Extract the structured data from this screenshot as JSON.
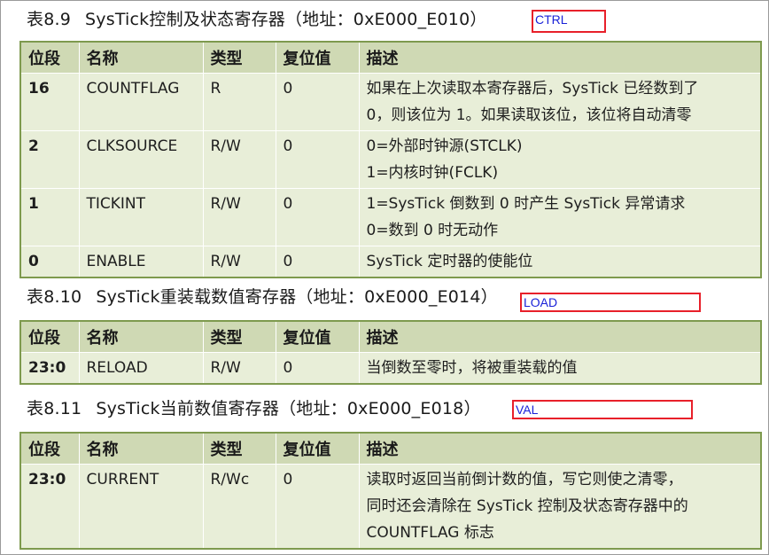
{
  "tables": [
    {
      "number": "表8.9",
      "title": "SysTick控制及状态寄存器（地址：0xE000_E010）",
      "annotation": "CTRL",
      "headers": [
        "位段",
        "名称",
        "类型",
        "复位值",
        "描述"
      ],
      "rows": [
        {
          "bits": "16",
          "name": "COUNTFLAG",
          "type": "R",
          "reset": "0",
          "desc": [
            "如果在上次读取本寄存器后，SysTick 已经数到了",
            "0，则该位为 1。如果读取该位，该位将自动清零"
          ]
        },
        {
          "bits": "2",
          "name": "CLKSOURCE",
          "type": "R/W",
          "reset": "0",
          "desc": [
            "0=外部时钟源(STCLK)",
            "1=内核时钟(FCLK)"
          ]
        },
        {
          "bits": "1",
          "name": "TICKINT",
          "type": "R/W",
          "reset": "0",
          "desc": [
            "1=SysTick 倒数到 0 时产生 SysTick 异常请求",
            "0=数到 0 时无动作"
          ]
        },
        {
          "bits": "0",
          "name": "ENABLE",
          "type": "R/W",
          "reset": "0",
          "desc": [
            "SysTick 定时器的使能位"
          ]
        }
      ]
    },
    {
      "number": "表8.10",
      "title": "SysTick重装载数值寄存器（地址：0xE000_E014）",
      "annotation": "LOAD",
      "headers": [
        "位段",
        "名称",
        "类型",
        "复位值",
        "描述"
      ],
      "rows": [
        {
          "bits": "23:0",
          "name": "RELOAD",
          "type": "R/W",
          "reset": "0",
          "desc": [
            "当倒数至零时，将被重装载的值"
          ]
        }
      ]
    },
    {
      "number": "表8.11",
      "title": "SysTick当前数值寄存器（地址：0xE000_E018）",
      "annotation": "VAL",
      "headers": [
        "位段",
        "名称",
        "类型",
        "复位值",
        "描述"
      ],
      "rows": [
        {
          "bits": "23:0",
          "name": "CURRENT",
          "type": "R/Wc",
          "reset": "0",
          "desc": [
            "读取时返回当前倒计数的值，写它则使之清零，",
            "同时还会清除在 SysTick 控制及状态寄存器中的",
            "COUNTFLAG 标志"
          ]
        }
      ]
    }
  ],
  "colors": {
    "header_bg": "#cfd9b4",
    "row_bg": "#e8eed8",
    "table_border": "#7e9a4e",
    "annotation_border": "#e8202a",
    "annotation_text": "#1a22d8"
  }
}
